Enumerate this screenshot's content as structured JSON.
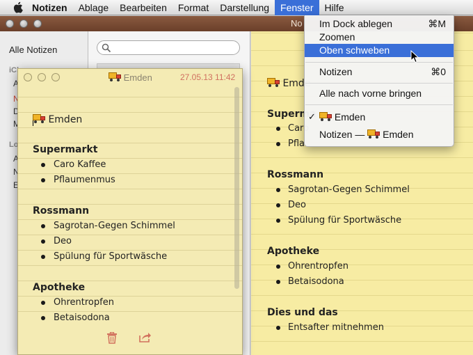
{
  "menubar": {
    "app_name": "Notizen",
    "items": [
      "Ablage",
      "Bearbeiten",
      "Format",
      "Darstellung",
      "Fenster",
      "Hilfe"
    ],
    "active": "Fenster"
  },
  "window": {
    "title_fragment": "No",
    "title_tail": "…"
  },
  "sidebar": {
    "all_notes": "Alle Notizen",
    "section_icloud": "iCl",
    "section_local": "Lo",
    "letters_group1": [
      "A",
      "N",
      "D",
      "M"
    ],
    "letters_group2": [
      "A",
      "N",
      "E"
    ]
  },
  "search": {
    "placeholder": ""
  },
  "note": {
    "title": "Emden",
    "sections": [
      {
        "heading": "Supermarkt",
        "items": [
          "Caro Kaffee",
          "Pflaumenmus"
        ]
      },
      {
        "heading": "Rossmann",
        "items": [
          "Sagrotan-Gegen Schimmel",
          "Deo",
          "Spülung für Sportwäsche"
        ]
      },
      {
        "heading": "Apotheke",
        "items": [
          "Ohrentropfen",
          "Betaisodona"
        ]
      },
      {
        "heading": "Dies und das",
        "items": [
          "Entsafter mitnehmen"
        ]
      }
    ],
    "back_title_fragment": "Emde",
    "back_heading_fragment": "Superma",
    "back_item_fragments": [
      "Caro",
      "Pfla"
    ]
  },
  "floating_note": {
    "title": "Emden",
    "date": "27.05.13 11:42"
  },
  "fenster_menu": {
    "items": [
      {
        "label": "Im Dock ablegen",
        "shortcut": "⌘M"
      },
      {
        "label": "Zoomen",
        "shortcut": ""
      },
      {
        "label": "Oben schweben",
        "shortcut": "",
        "highlighted": true
      },
      {
        "label": "Notizen",
        "shortcut": "⌘0"
      },
      {
        "label": "Alle nach vorne bringen",
        "shortcut": ""
      },
      {
        "label": "Emden",
        "checked": true,
        "check": "✓"
      },
      {
        "label_prefix": "Notizen — ",
        "label": "Emden"
      }
    ]
  },
  "icons": {
    "apple": "apple-logo-icon",
    "truck": "delivery-truck-icon",
    "trash": "trash-icon",
    "share": "share-icon",
    "search": "search-icon",
    "cursor": "mouse-pointer-icon"
  },
  "colors": {
    "menu_highlight": "#3a6fd8",
    "note_paper": "#f7eca3",
    "date_text": "#d07060",
    "footer_icon": "#d1705c"
  }
}
